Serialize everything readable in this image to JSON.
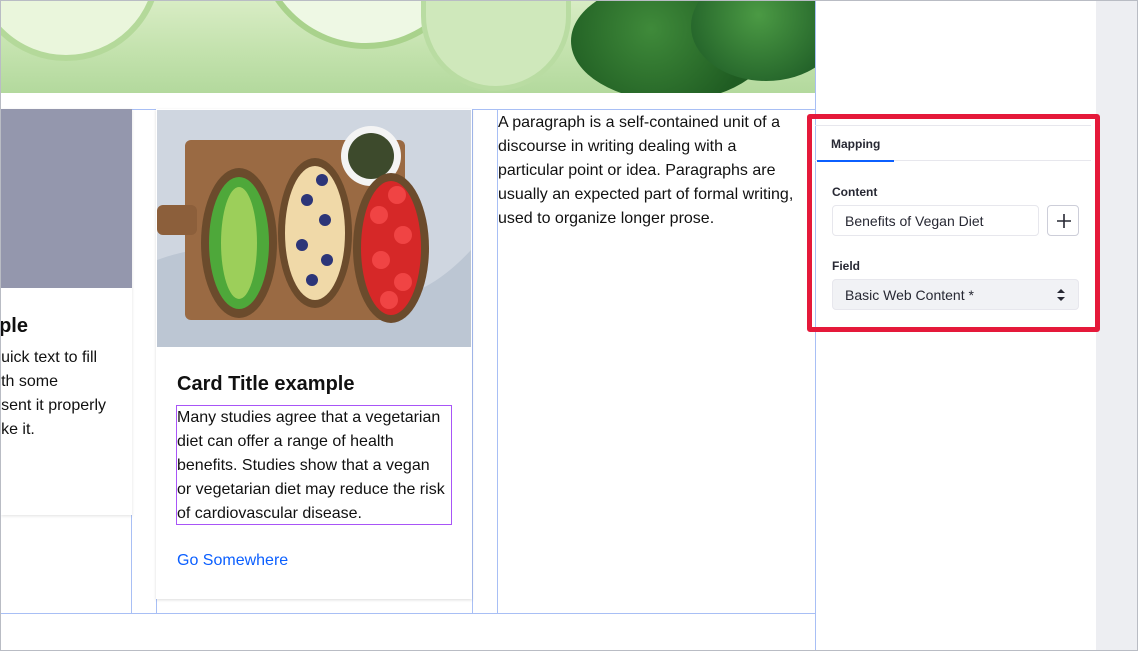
{
  "left_card": {
    "title": "ple",
    "lines": [
      "uick text to fill",
      "th some",
      "sent it properly",
      "ke it."
    ]
  },
  "middle_card": {
    "title": "Card Title example",
    "lines": [
      "Many studies agree that a vegetarian",
      "diet can offer a range of health",
      "benefits. Studies show that a vegan",
      "or vegetarian diet may reduce the risk",
      "of cardiovascular disease."
    ],
    "link": "Go Somewhere"
  },
  "paragraph": {
    "lines": [
      "A paragraph is a self-contained unit of a",
      "discourse in writing dealing with a",
      "particular point or idea. Paragraphs are",
      "usually an expected part of formal writing,",
      "used to organize longer prose."
    ]
  },
  "sidebar": {
    "tab": "Mapping",
    "content_label": "Content",
    "content_value": "Benefits of Vegan Diet",
    "field_label": "Field",
    "field_value": "Basic Web Content *",
    "add_icon": "plus-icon",
    "select_icon": "caret-double-icon"
  },
  "colors": {
    "accent": "#0b5fff",
    "highlight": "#e5193a",
    "selection": "#a855f7",
    "grid": "#a8bff5"
  }
}
